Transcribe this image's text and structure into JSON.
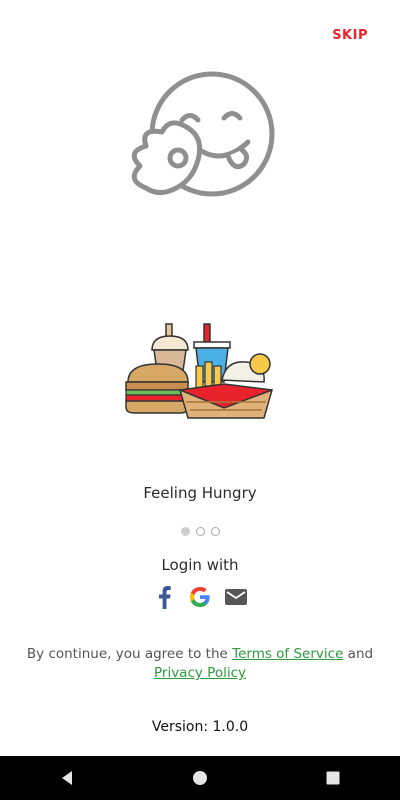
{
  "header": {
    "skip_label": "SKIP"
  },
  "slide": {
    "title": "Feeling Hungry",
    "total_pages": 3,
    "active_page": 1
  },
  "login": {
    "label": "Login with",
    "providers": [
      {
        "name": "facebook-icon",
        "color": "#3b5998"
      },
      {
        "name": "google-icon"
      },
      {
        "name": "email-icon",
        "color": "#555555"
      }
    ]
  },
  "terms": {
    "prefix": "By continue, you agree to the",
    "terms_link": "Terms of Service",
    "conjunction": "and",
    "privacy_link": "Privacy Policy",
    "link_color": "#2e9a3a"
  },
  "footer": {
    "version": "Version: 1.0.0"
  },
  "colors": {
    "accent": "#e8232b",
    "background": "#ffffff"
  },
  "system_nav": {
    "icons": [
      "back-icon",
      "home-icon",
      "recents-icon"
    ]
  }
}
